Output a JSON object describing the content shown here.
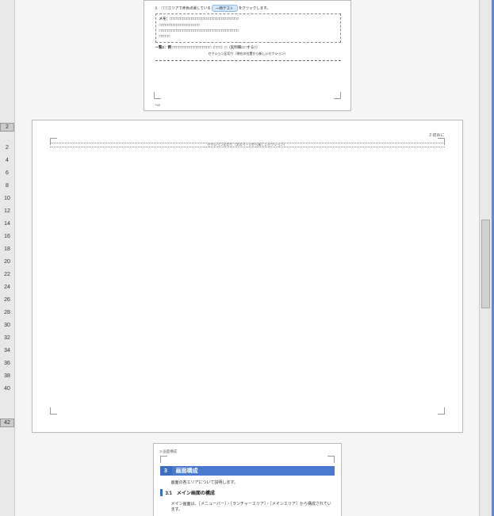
{
  "vruler": {
    "top_indicator": "2",
    "bottom_indicator": "42",
    "ticks": [
      "2",
      "4",
      "6",
      "8",
      "10",
      "12",
      "14",
      "16",
      "18",
      "20",
      "22",
      "24",
      "26",
      "28",
      "30",
      "32",
      "34",
      "36",
      "38",
      "40"
    ]
  },
  "page1": {
    "line1_prefix": "3.　□□□エリアで赤色点滅している",
    "line1_badge": "一時テスト",
    "line1_suffix": "をクリックします。",
    "memo_label": "メモ：",
    "memo_line1": "□□□□□□□□□□□□□□□□□□□□□□□□□□□□□□□□",
    "memo_line2": "□□□□□□□□□□□□□□□□□□□",
    "memo_line3": "□□□□□□□□□□□□□□□□□□□□□□□□□□□□□□□□□□□□□",
    "memo_line4": "□□□□□",
    "cap_label": "一覧1：例",
    "cap_text": "□□□□□□□□□□□□□□□□□□（□□□）□（実例欄に□する□）",
    "cap2": "セクション区切り（現在の位置から新しいセクション）",
    "foot_left": "↪4"
  },
  "page2": {
    "head_right": "2 初めに",
    "hruler_text": "セクション区切り（次のページから新しいセクション）"
  },
  "page3": {
    "foot": "3  画面構成",
    "chapter_num": "3",
    "chapter_title": "画面構成",
    "lead": "画面の各エリアについて説明します。",
    "section": "3.1　メイン画面の構成",
    "para": "メイン画面は、［メニューバー］・［ランチャーエリア］・［メインエリア］から構成されています。"
  },
  "chart_data": null
}
